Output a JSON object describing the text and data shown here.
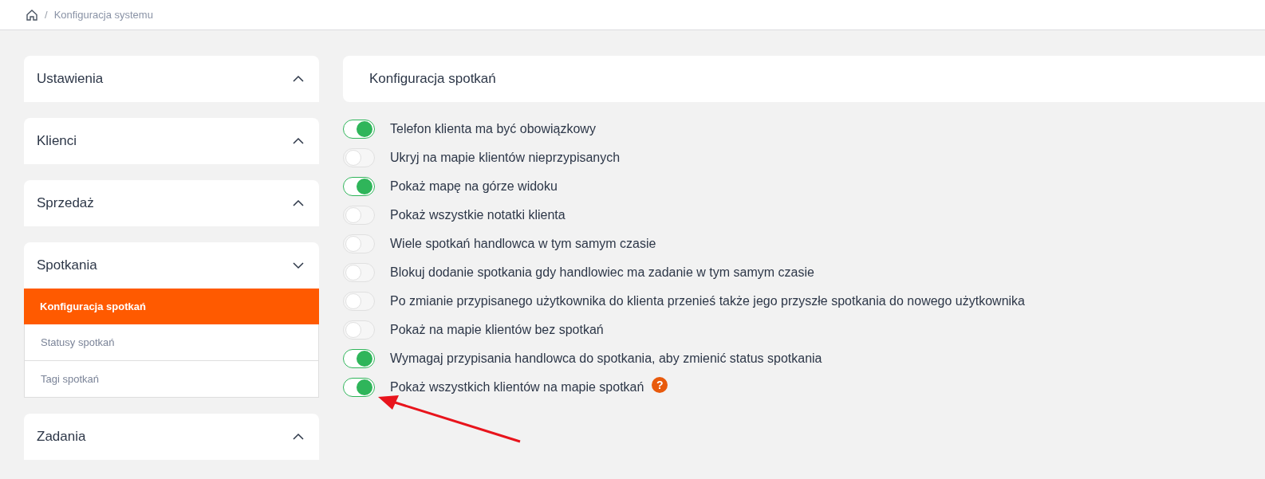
{
  "breadcrumb": {
    "separator": "/",
    "current": "Konfiguracja systemu"
  },
  "sidebar": {
    "sections": [
      {
        "title": "Ustawienia",
        "expanded": false
      },
      {
        "title": "Klienci",
        "expanded": false
      },
      {
        "title": "Sprzedaż",
        "expanded": false
      },
      {
        "title": "Spotkania",
        "expanded": true,
        "items": [
          {
            "label": "Konfiguracja spotkań",
            "selected": true
          },
          {
            "label": "Statusy spotkań",
            "selected": false
          },
          {
            "label": "Tagi spotkań",
            "selected": false
          }
        ]
      },
      {
        "title": "Zadania",
        "expanded": false
      }
    ]
  },
  "panel": {
    "title": "Konfiguracja spotkań"
  },
  "settings": [
    {
      "label": "Telefon klienta ma być obowiązkowy",
      "on": true
    },
    {
      "label": "Ukryj na mapie klientów nieprzypisanych",
      "on": false
    },
    {
      "label": "Pokaż mapę na górze widoku",
      "on": true
    },
    {
      "label": "Pokaż wszystkie notatki klienta",
      "on": false
    },
    {
      "label": "Wiele spotkań handlowca w tym samym czasie",
      "on": false
    },
    {
      "label": "Blokuj dodanie spotkania gdy handlowiec ma zadanie w tym samym czasie",
      "on": false
    },
    {
      "label": "Po zmianie przypisanego użytkownika do klienta przenieś także jego przyszłe spotkania do nowego użytkownika",
      "on": false
    },
    {
      "label": "Pokaż na mapie klientów bez spotkań",
      "on": false
    },
    {
      "label": "Wymagaj przypisania handlowca do spotkania, aby zmienić status spotkania",
      "on": true
    },
    {
      "label": "Pokaż wszystkich klientów na mapie spotkań",
      "on": true,
      "help": "?"
    }
  ]
}
